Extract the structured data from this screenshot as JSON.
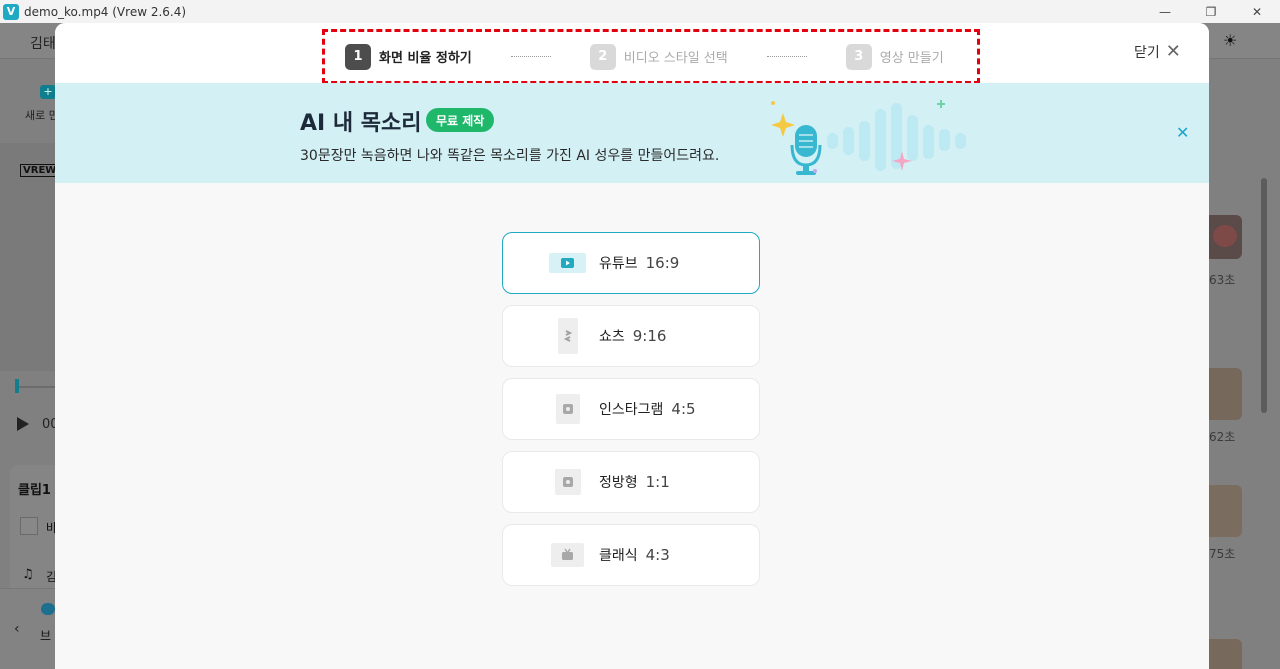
{
  "window": {
    "title": "demo_ko.mp4 (Vrew 2.6.4)",
    "logo_letter": "V",
    "controls": [
      "—",
      "❐",
      "✕"
    ]
  },
  "background": {
    "user_partial": "김태",
    "new_partial": "새로 만",
    "new_icon": "+",
    "watermark": "VREW",
    "time_partial": "00",
    "clip_title": "클립1",
    "clip_char": "바",
    "music_char": "김",
    "bottom_partial": "브",
    "durations": [
      "63초",
      "62초",
      "75초"
    ]
  },
  "stepper": {
    "steps": [
      {
        "num": "1",
        "label": "화면 비율 정하기",
        "state": "active"
      },
      {
        "num": "2",
        "label": "비디오 스타일 선택",
        "state": "inactive"
      },
      {
        "num": "3",
        "label": "영상 만들기",
        "state": "inactive"
      }
    ],
    "highlight_color": "#e3000f"
  },
  "close": {
    "label": "닫기",
    "icon": "close-icon"
  },
  "banner": {
    "title": "AI 내 목소리",
    "badge": "무료 제작",
    "subtitle": "30문장만 녹음하면 나와 똑같은 목소리를 가진 AI 성우를 만들어드려요.",
    "background_color": "#d3f0f5",
    "badge_color": "#1fb86a"
  },
  "options": [
    {
      "label": "유튜브",
      "ratio": "16:9",
      "icon": "youtube-icon",
      "selected": true
    },
    {
      "label": "쇼츠",
      "ratio": "9:16",
      "icon": "shorts-icon",
      "selected": false
    },
    {
      "label": "인스타그램",
      "ratio": "4:5",
      "icon": "instagram-icon",
      "selected": false
    },
    {
      "label": "정방형",
      "ratio": "1:1",
      "icon": "square-icon",
      "selected": false
    },
    {
      "label": "클래식",
      "ratio": "4:3",
      "icon": "tv-icon",
      "selected": false
    }
  ],
  "accent_color": "#21a9c0"
}
